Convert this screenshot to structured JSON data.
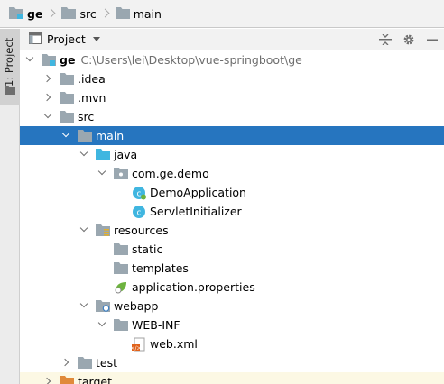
{
  "breadcrumb": [
    {
      "label": "ge",
      "icon": "project-folder-icon",
      "bold": true
    },
    {
      "label": "src",
      "icon": "folder-icon",
      "bold": false
    },
    {
      "label": "main",
      "icon": "folder-icon",
      "bold": false
    }
  ],
  "side_strip": {
    "tab_label": "1: Project"
  },
  "panel": {
    "title": "Project",
    "actions": [
      "collapse-all-icon",
      "gear-icon",
      "hide-icon"
    ]
  },
  "tree": [
    {
      "label": "ge",
      "path": "C:\\Users\\lei\\Desktop\\vue-springboot\\ge",
      "depth": 0,
      "expanded": true,
      "icon": "module-folder-icon",
      "bold": true
    },
    {
      "label": ".idea",
      "depth": 1,
      "expanded": false,
      "icon": "folder-icon"
    },
    {
      "label": ".mvn",
      "depth": 1,
      "expanded": false,
      "icon": "folder-icon"
    },
    {
      "label": "src",
      "depth": 1,
      "expanded": true,
      "icon": "folder-icon"
    },
    {
      "label": "main",
      "depth": 2,
      "expanded": true,
      "icon": "folder-icon",
      "selected": true
    },
    {
      "label": "java",
      "depth": 3,
      "expanded": true,
      "icon": "source-root-icon"
    },
    {
      "label": "com.ge.demo",
      "depth": 4,
      "expanded": true,
      "icon": "package-icon"
    },
    {
      "label": "DemoApplication",
      "depth": 5,
      "icon": "spring-class-icon"
    },
    {
      "label": "ServletInitializer",
      "depth": 5,
      "icon": "class-icon"
    },
    {
      "label": "resources",
      "depth": 3,
      "expanded": true,
      "icon": "resources-root-icon"
    },
    {
      "label": "static",
      "depth": 4,
      "icon": "folder-icon"
    },
    {
      "label": "templates",
      "depth": 4,
      "icon": "folder-icon"
    },
    {
      "label": "application.properties",
      "depth": 4,
      "icon": "spring-properties-icon"
    },
    {
      "label": "webapp",
      "depth": 3,
      "expanded": true,
      "icon": "web-folder-icon"
    },
    {
      "label": "WEB-INF",
      "depth": 4,
      "expanded": true,
      "icon": "folder-icon"
    },
    {
      "label": "web.xml",
      "depth": 5,
      "icon": "xml-file-icon"
    },
    {
      "label": "test",
      "depth": 2,
      "expanded": false,
      "icon": "folder-icon"
    },
    {
      "label": "target",
      "depth": 1,
      "expanded": false,
      "icon": "excluded-folder-icon"
    }
  ],
  "colors": {
    "selection": "#2675bf",
    "folder": "#9aa7b0",
    "source_root": "#40b6e0",
    "class": "#40b6e0",
    "spring": "#6db33f",
    "excluded": "#e08a3a"
  }
}
